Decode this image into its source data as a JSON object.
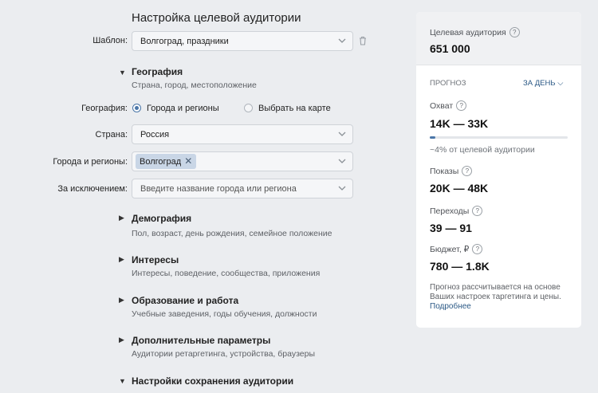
{
  "page_title": "Настройка целевой аудитории",
  "template": {
    "label": "Шаблон:",
    "value": "Волгоград, праздники"
  },
  "geography_section": {
    "title": "География",
    "subtitle": "Страна, город, местоположение"
  },
  "geography": {
    "label": "География:",
    "option_cities": "Города и регионы",
    "option_map": "Выбрать на карте",
    "selected": "cities"
  },
  "country": {
    "label": "Страна:",
    "value": "Россия"
  },
  "cities": {
    "label": "Города и регионы:",
    "tags": [
      "Волгоград"
    ]
  },
  "exclude": {
    "label": "За исключением:",
    "placeholder": "Введите название города или региона"
  },
  "sections": [
    {
      "title": "Демография",
      "subtitle": "Пол, возраст, день рождения, семейное положение"
    },
    {
      "title": "Интересы",
      "subtitle": "Интересы, поведение, сообщества, приложения"
    },
    {
      "title": "Образование и работа",
      "subtitle": "Учебные заведения, годы обучения, должности"
    },
    {
      "title": "Дополнительные параметры",
      "subtitle": "Аудитории ретаргетинга, устройства, браузеры"
    },
    {
      "title": "Настройки сохранения аудитории",
      "subtitle": ""
    }
  ],
  "panel": {
    "audience_label": "Целевая аудитория",
    "audience_value": "651 000",
    "forecast_label": "ПРОГНОЗ",
    "period_label": "ЗА ДЕНЬ",
    "reach_label": "Охват",
    "reach_value": "14K — 33K",
    "reach_fraction": 0.04,
    "reach_note": "~4% от целевой аудитории",
    "impressions_label": "Показы",
    "impressions_value": "20K — 48K",
    "clicks_label": "Переходы",
    "clicks_value": "39 — 91",
    "budget_label": "Бюджет, ₽",
    "budget_value": "780 — 1.8K",
    "note_text": "Прогноз рассчитывается на основе Ваших настроек таргетинга и цены.",
    "note_link": "Подробнее",
    "accent_color": "#4a76a8"
  }
}
